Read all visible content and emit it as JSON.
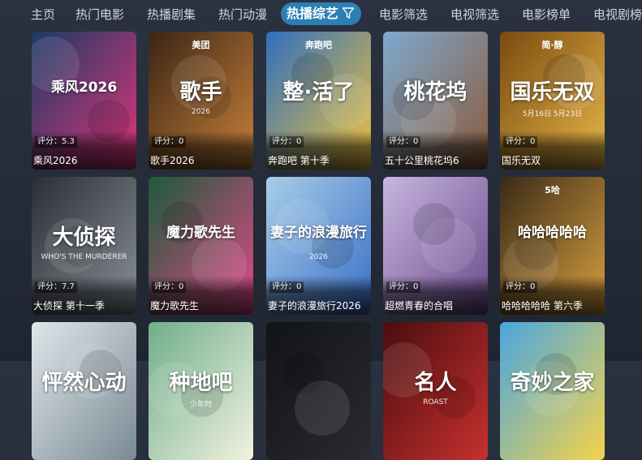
{
  "nav": {
    "tabs": [
      {
        "label": "主页"
      },
      {
        "label": "热门电影"
      },
      {
        "label": "热播剧集"
      },
      {
        "label": "热门动漫"
      },
      {
        "label": "热播综艺"
      },
      {
        "label": "电影筛选"
      },
      {
        "label": "电视筛选"
      },
      {
        "label": "电影榜单"
      },
      {
        "label": "电视剧榜"
      }
    ],
    "active_index": 4,
    "active_icon": "filter-icon"
  },
  "grid": {
    "items": [
      {
        "title": "乘风2026",
        "rating": "评分：5.3",
        "poster_text": "乘风2026",
        "colors": [
          "#1b3a66",
          "#e0357a"
        ]
      },
      {
        "title": "歌手2026",
        "rating": "评分：0",
        "poster_text": "歌手",
        "poster_badge": "美团",
        "poster_sub": "2026",
        "colors": [
          "#3a2515",
          "#c9823a"
        ]
      },
      {
        "title": "奔跑吧 第十季",
        "rating": "评分：0",
        "poster_text": "整·活了",
        "poster_badge": "奔跑吧",
        "colors": [
          "#2f6fbf",
          "#f0c23a"
        ]
      },
      {
        "title": "五十公里桃花坞6",
        "rating": "评分：0",
        "poster_text": "桃花坞",
        "colors": [
          "#7ea9cf",
          "#8a5a3a"
        ]
      },
      {
        "title": "国乐无双",
        "rating": "评分：0",
        "poster_text": "国乐无双",
        "poster_badge": "简·醇",
        "poster_sub": "5月16日 5月23日",
        "colors": [
          "#7a4a10",
          "#e8b84a"
        ]
      },
      {
        "title": "大侦探 第十一季",
        "rating": "评分：7.7",
        "poster_text": "大侦探",
        "poster_sub": "WHO'S THE MURDERER",
        "colors": [
          "#2a2f35",
          "#8a9098"
        ]
      },
      {
        "title": "魔力歌先生",
        "rating": "评分：0",
        "poster_text": "魔力歌先生",
        "colors": [
          "#1d5a3a",
          "#e24a8a"
        ]
      },
      {
        "title": "妻子的浪漫旅行2026",
        "rating": "评分：0",
        "poster_text": "妻子的浪漫旅行",
        "poster_sub": "2026",
        "colors": [
          "#a8cde8",
          "#3a6fc8"
        ]
      },
      {
        "title": "超燃青春的合唱",
        "rating": "评分：0",
        "poster_text": "",
        "colors": [
          "#c8b6e0",
          "#6a4a8a"
        ]
      },
      {
        "title": "哈哈哈哈哈 第六季",
        "rating": "评分：0",
        "poster_text": "哈哈哈哈哈",
        "poster_badge": "5哈",
        "colors": [
          "#3a2a18",
          "#d8a040"
        ]
      },
      {
        "title": "",
        "rating": "",
        "poster_text": "怦然心动",
        "colors": [
          "#dfe6ea",
          "#7a8a94"
        ]
      },
      {
        "title": "",
        "rating": "",
        "poster_text": "种地吧",
        "poster_sub": "少年时",
        "colors": [
          "#6fae8a",
          "#f2f2e0"
        ]
      },
      {
        "title": "",
        "rating": "",
        "poster_text": "",
        "colors": [
          "#121316",
          "#2a2b30"
        ]
      },
      {
        "title": "",
        "rating": "",
        "poster_text": "名人",
        "poster_sub": "ROAST",
        "colors": [
          "#4a0d0d",
          "#c83030"
        ]
      },
      {
        "title": "",
        "rating": "",
        "poster_text": "奇妙之家",
        "colors": [
          "#4aa6e0",
          "#f5d34a"
        ]
      }
    ]
  }
}
